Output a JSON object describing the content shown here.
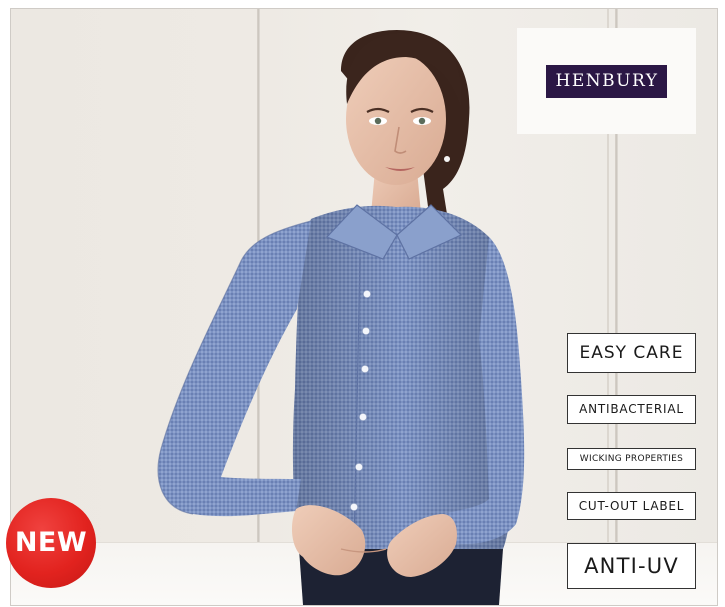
{
  "brand": {
    "logo_text": "HENBURY",
    "logo_color": "#2b1745"
  },
  "features": [
    "EASY CARE",
    "ANTIBACTERIAL",
    "WICKING PROPERTIES",
    "CUT-OUT LABEL",
    "ANTI-UV"
  ],
  "badge": {
    "label": "NEW",
    "color": "#e2231f"
  },
  "photo": {
    "subject": "woman-in-blue-long-sleeve-shirt",
    "shirt_color": "#7f95c4",
    "trouser_color": "#1d2233"
  }
}
